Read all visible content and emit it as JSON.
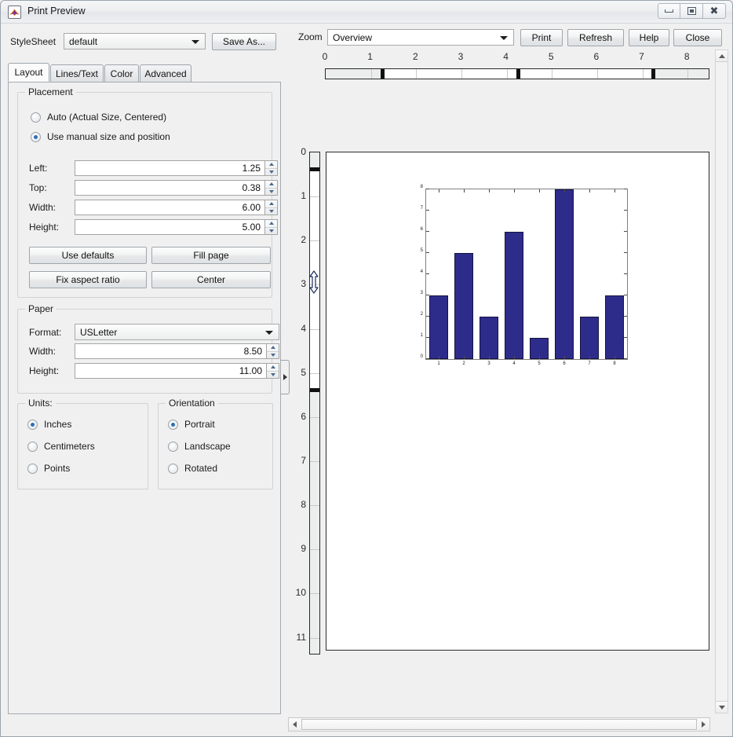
{
  "window": {
    "title": "Print Preview",
    "icon": "matlab-icon",
    "minimize_label": "minimize",
    "maximize_label": "maximize",
    "close_label": "close"
  },
  "toolbar": {
    "stylesheet_label": "StyleSheet",
    "stylesheet_value": "default",
    "save_as_label": "Save As...",
    "zoom_label": "Zoom",
    "zoom_value": "Overview",
    "print_label": "Print",
    "refresh_label": "Refresh",
    "help_label": "Help",
    "close_label": "Close"
  },
  "tabs": [
    {
      "label": "Layout",
      "active": true
    },
    {
      "label": "Lines/Text",
      "active": false
    },
    {
      "label": "Color",
      "active": false
    },
    {
      "label": "Advanced",
      "active": false
    }
  ],
  "placement": {
    "title": "Placement",
    "options": [
      {
        "label": "Auto (Actual Size, Centered)",
        "selected": false
      },
      {
        "label": "Use manual size and position",
        "selected": true
      }
    ],
    "fields": [
      {
        "label": "Left:",
        "value": "1.25"
      },
      {
        "label": "Top:",
        "value": "0.38"
      },
      {
        "label": "Width:",
        "value": "6.00"
      },
      {
        "label": "Height:",
        "value": "5.00"
      }
    ],
    "buttons": [
      {
        "label": "Use defaults"
      },
      {
        "label": "Fill page"
      },
      {
        "label": "Fix aspect ratio"
      },
      {
        "label": "Center"
      }
    ]
  },
  "paper": {
    "title": "Paper",
    "format_label": "Format:",
    "format_value": "USLetter",
    "fields": [
      {
        "label": "Width:",
        "value": "8.50"
      },
      {
        "label": "Height:",
        "value": "11.00"
      }
    ]
  },
  "units": {
    "title": "Units:",
    "options": [
      {
        "label": "Inches",
        "selected": true
      },
      {
        "label": "Centimeters",
        "selected": false
      },
      {
        "label": "Points",
        "selected": false
      }
    ]
  },
  "orientation": {
    "title": "Orientation",
    "options": [
      {
        "label": "Portrait",
        "selected": true
      },
      {
        "label": "Landscape",
        "selected": false
      },
      {
        "label": "Rotated",
        "selected": false
      }
    ]
  },
  "rulers": {
    "horizontal_ticks": [
      "0",
      "1",
      "2",
      "3",
      "4",
      "5",
      "6",
      "7",
      "8"
    ],
    "horizontal_markers": [
      1.25,
      4.25,
      7.25
    ],
    "vertical_ticks": [
      "0",
      "1",
      "2",
      "3",
      "4",
      "5",
      "6",
      "7",
      "8",
      "9",
      "10",
      "11"
    ],
    "vertical_markers": [
      0.38,
      5.38
    ],
    "cursor_icon": "vertical-resize-cursor"
  },
  "splitter": {
    "icon": "collapse-panel-chevron-icon"
  },
  "chart_data": {
    "type": "bar",
    "categories": [
      "1",
      "2",
      "3",
      "4",
      "5",
      "6",
      "7",
      "8"
    ],
    "values": [
      3,
      5,
      2,
      6,
      1,
      8,
      2,
      3
    ],
    "title": "",
    "xlabel": "",
    "ylabel": "",
    "ylim": [
      0,
      8
    ],
    "yticks": [
      0,
      1,
      2,
      3,
      4,
      5,
      6,
      7,
      8
    ],
    "grid": false,
    "legend": null,
    "bar_color": "#2e2c8b",
    "bar_edge_color": "#151440"
  },
  "scrollbars": {
    "vertical_up_icon": "scroll-up-arrow-icon",
    "vertical_down_icon": "scroll-down-arrow-icon",
    "horizontal_left_icon": "scroll-left-arrow-icon",
    "horizontal_right_icon": "scroll-right-arrow-icon"
  }
}
